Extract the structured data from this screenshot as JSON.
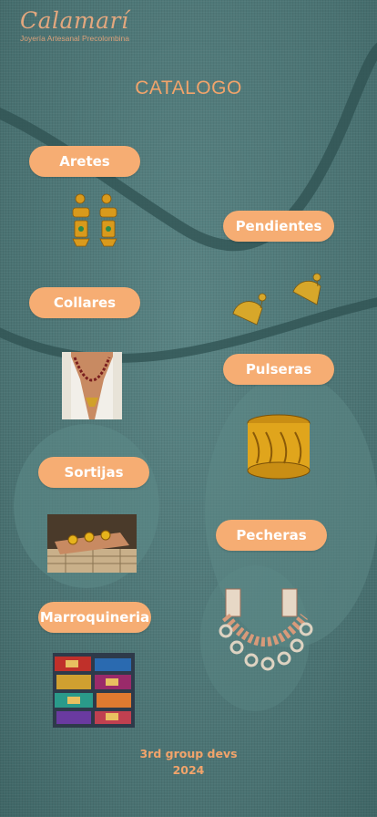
{
  "brand": {
    "name": "Calamarí",
    "subtitle": "Joyería Artesanal Precolombina"
  },
  "page_title": "CATALOGO",
  "categories": [
    {
      "label": "Aretes"
    },
    {
      "label": "Pendientes"
    },
    {
      "label": "Collares"
    },
    {
      "label": "Pulseras"
    },
    {
      "label": "Sortijas"
    },
    {
      "label": "Pecheras"
    },
    {
      "label": "Marroquineria"
    }
  ],
  "footer": {
    "line1": "3rd group devs",
    "line2": "2024"
  },
  "colors": {
    "accent": "#f6ad73",
    "title": "#f2a46b",
    "background": "#4f7878"
  }
}
